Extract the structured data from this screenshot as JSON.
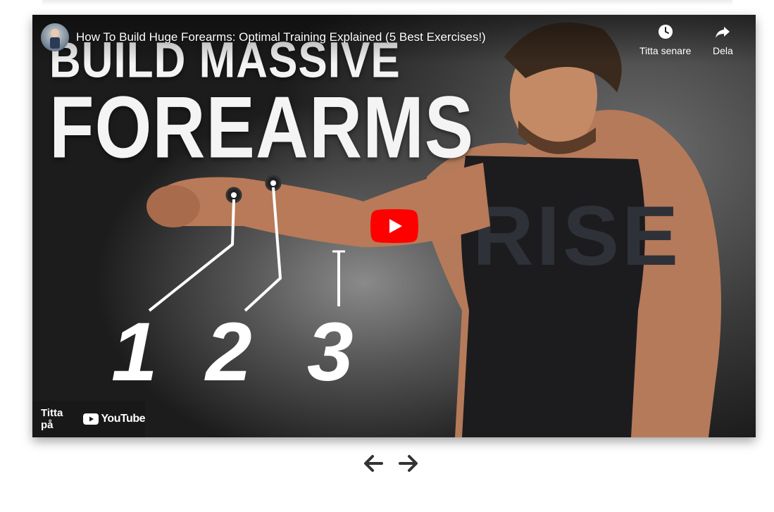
{
  "video": {
    "title": "How To Build Huge Forearms: Optimal Training Explained (5 Best Exercises!)",
    "thumbnail": {
      "headline_line1": "BUILD MASSIVE",
      "headline_line2": "FOREARMS",
      "numbers": [
        "1",
        "2",
        "3"
      ],
      "shirt_text": "RISE"
    }
  },
  "actions": {
    "watch_later_label": "Titta senare",
    "share_label": "Dela"
  },
  "watch_on": {
    "label": "Titta på",
    "logo_text": "YouTube"
  },
  "icons": {
    "watch_later": "clock-icon",
    "share": "share-arrow-icon",
    "play": "play-icon",
    "youtube": "youtube-logo",
    "prev": "arrow-left-icon",
    "next": "arrow-right-icon"
  },
  "colors": {
    "play_red": "#ff0000",
    "nav_arrows": "#333333"
  }
}
